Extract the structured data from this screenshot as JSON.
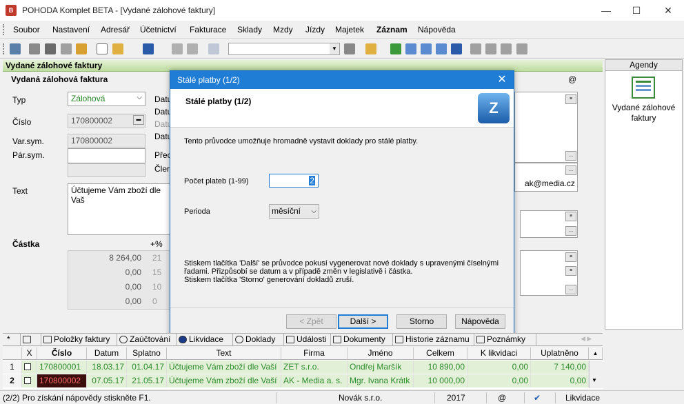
{
  "window": {
    "title": "POHODA Komplet BETA - [Vydané zálohové faktury]",
    "app_icon_text": "B",
    "minimize": "—",
    "maximize": "☐",
    "close": "✕"
  },
  "menu": [
    "Soubor",
    "Nastavení",
    "Adresář",
    "Účetnictví",
    "Fakturace",
    "Sklady",
    "Mzdy",
    "Jízdy",
    "Majetek",
    "Záznam",
    "Nápověda"
  ],
  "form": {
    "header": "Vydané zálohové faktury",
    "subheader": "Vydaná zálohová faktura",
    "typ_label": "Typ",
    "typ_value": "Zálohová",
    "cislo_label": "Číslo",
    "cislo_value": "170800002",
    "varsym_label": "Var.sym.",
    "varsym_value": "170800002",
    "parsym_label": "Pár.sym.",
    "text_label": "Text",
    "text_value": "Účtujeme Vám zboží dle Vaš",
    "castka_label": "Částka",
    "percent_label": "+%",
    "amounts": [
      {
        "value": "8 264,00",
        "rate": "21"
      },
      {
        "value": "0,00",
        "rate": "15"
      },
      {
        "value": "0,00",
        "rate": "10"
      },
      {
        "value": "0,00",
        "rate": "0"
      }
    ],
    "date_labels": [
      "Datu",
      "Datu",
      "Datu",
      "Datu",
      "Přec",
      "Čler"
    ],
    "email_partial": "ak@media.cz",
    "at_symbol": "@"
  },
  "agendy": {
    "header": "Agendy",
    "item_label": "Vydané zálohové faktury"
  },
  "dialog": {
    "title": "Stálé platby (1/2)",
    "heading": "Stálé platby (1/2)",
    "intro": "Tento průvodce umožňuje hromadně vystavit doklady pro stálé platby.",
    "count_label": "Počet plateb (1-99)",
    "count_value": "2",
    "period_label": "Perioda",
    "period_value": "měsíční",
    "note_line1": "Stiskem tlačítka 'Další' se průvodce pokusí vygenerovat nové doklady s upravenými číselnými",
    "note_line2": "řadami. Přizpůsobí se datum a v případě změn v legislativě i částka.",
    "note_line3": "Stiskem tlačítka 'Storno' generování dokladů zruší.",
    "btn_back": "< Zpět",
    "btn_next": "Další >",
    "btn_cancel": "Storno",
    "btn_help": "Nápověda",
    "logo": "Z"
  },
  "tabs": [
    "*",
    "Položky faktury",
    "Zaúčtování",
    "Likvidace",
    "Doklady",
    "Události",
    "Dokumenty",
    "Historie záznamu",
    "Poznámky"
  ],
  "table": {
    "columns": [
      "X",
      "Číslo",
      "Datum",
      "Splatno",
      "Text",
      "Firma",
      "Jméno",
      "Celkem",
      "K likvidaci",
      "Uplatněno"
    ],
    "rows": [
      {
        "n": "1",
        "cislo": "170800001",
        "datum": "18.03.17",
        "splatno": "01.04.17",
        "text": "Účtujeme Vám zboží dle Vaší",
        "firma": "ZET s.r.o.",
        "jmeno": "Ondřej Maršík",
        "celkem": "10 890,00",
        "klikvidaci": "0,00",
        "uplatneno": "7 140,00"
      },
      {
        "n": "2",
        "cislo": "170800002",
        "datum": "07.05.17",
        "splatno": "21.05.17",
        "text": "Účtujeme Vám zboží dle Vaší",
        "firma": "AK - Media a. s.",
        "jmeno": "Mgr. Ivana Krátk",
        "celkem": "10 000,00",
        "klikvidaci": "0,00",
        "uplatneno": "0,00"
      }
    ]
  },
  "status": {
    "hint": "(2/2) Pro získání nápovědy stiskněte F1.",
    "company": "Novák s.r.o.",
    "year": "2017",
    "at": "@",
    "check": "✔",
    "agenda": "Likvidace"
  },
  "colors": {
    "accent": "#1f7dd6",
    "form_header": "#bfdca0",
    "row_highlight": "#e3f0d8",
    "selected_number_bg": "#3b0d0d"
  }
}
